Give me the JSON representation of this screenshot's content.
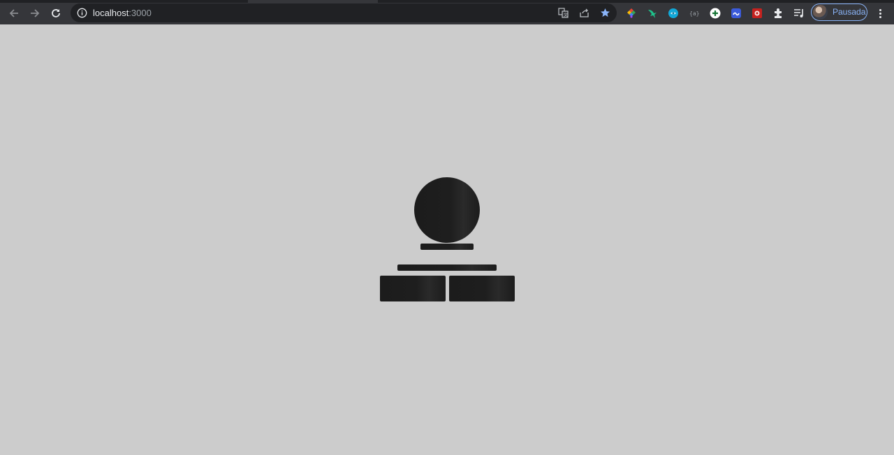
{
  "browser": {
    "address_bar": {
      "host": "localhost",
      "port": ":3000"
    },
    "profile": {
      "name": "Pausada"
    },
    "icons": {
      "back": "back-arrow-icon",
      "forward": "forward-arrow-icon",
      "reload": "reload-icon",
      "site_info": "info-icon",
      "translate": "translate-icon",
      "share": "share-icon",
      "bookmark": "star-icon",
      "extensions": [
        "color-picker-extension-icon",
        "hummingbird-extension-icon",
        "teal-extension-icon",
        "json-extension-icon",
        "plus-extension-icon",
        "link-extension-icon",
        "red-extension-icon",
        "puzzle-icon",
        "reading-list-icon"
      ],
      "menu": "more-vert-icon"
    },
    "accent": "#8ab4f8"
  },
  "page": {
    "background": "#cccccc",
    "state": "loading-skeleton",
    "skeleton_color": "#1c1c1c"
  }
}
